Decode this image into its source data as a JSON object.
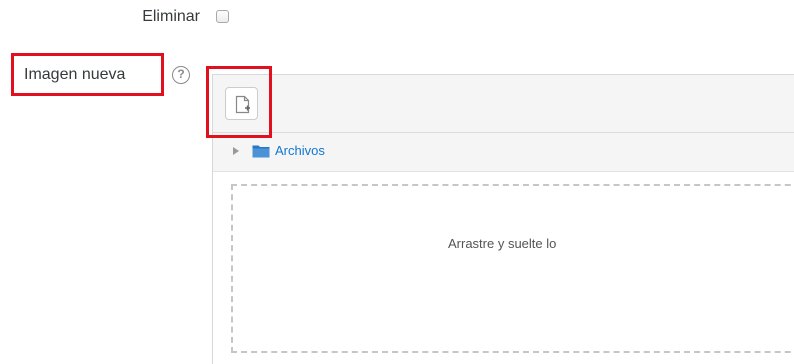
{
  "delete_row": {
    "label": "Eliminar",
    "checked": false
  },
  "new_image": {
    "label": "Imagen nueva",
    "help_icon": "help-question-icon"
  },
  "filemanager": {
    "toolbar": {
      "add_button_icon": "add-file-icon"
    },
    "path": {
      "folder_icon": "folder-icon",
      "folder_name": "Archivos"
    },
    "dropzone": {
      "text": "Arrastre y suelte lo"
    }
  },
  "colors": {
    "highlight": "#e0101e",
    "link": "#1177d1",
    "folder": "#2a78c2"
  }
}
